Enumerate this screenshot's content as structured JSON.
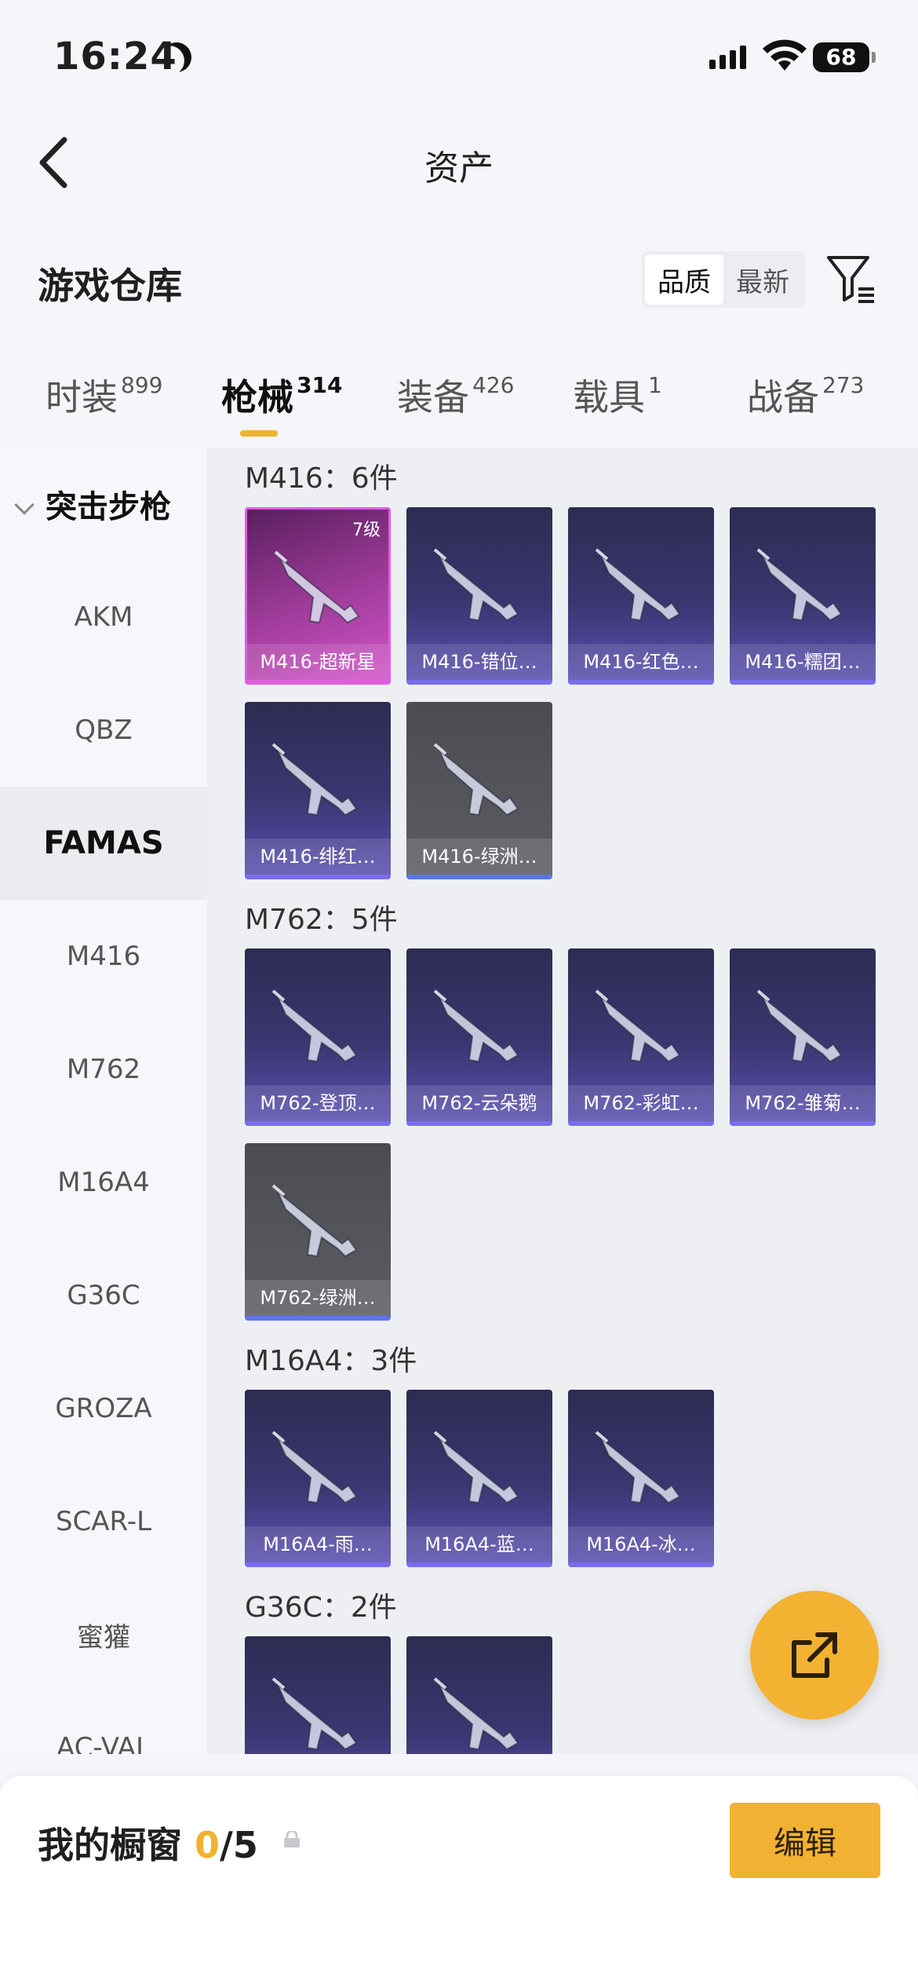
{
  "status": {
    "time": "16:24",
    "battery": "68"
  },
  "nav": {
    "title": "资产"
  },
  "warehouse": {
    "title": "游戏仓库",
    "sort": [
      "品质",
      "最新"
    ],
    "active_sort": "品质"
  },
  "tabs": [
    {
      "label": "时装",
      "count": "899"
    },
    {
      "label": "枪械",
      "count": "314"
    },
    {
      "label": "装备",
      "count": "426"
    },
    {
      "label": "载具",
      "count": "1"
    },
    {
      "label": "战备",
      "count": "273"
    }
  ],
  "sidebar": {
    "category": "突击步枪",
    "items": [
      "AKM",
      "QBZ",
      "FAMAS",
      "M416",
      "M762",
      "M16A4",
      "G36C",
      "GROZA",
      "SCAR-L",
      "蜜獾",
      "AC-VAL"
    ],
    "active": "FAMAS"
  },
  "groups": [
    {
      "title": "M416：6件",
      "items": [
        {
          "name": "M416-超新星",
          "level": "7级",
          "rarity": "purple"
        },
        {
          "name": "M416-错位…",
          "rarity": "blue"
        },
        {
          "name": "M416-红色…",
          "rarity": "blue"
        },
        {
          "name": "M416-糯团…",
          "rarity": "blue"
        },
        {
          "name": "M416-绯红…",
          "rarity": "blue"
        },
        {
          "name": "M416-绿洲…",
          "rarity": "grey"
        }
      ]
    },
    {
      "title": "M762：5件",
      "items": [
        {
          "name": "M762-登顶…",
          "rarity": "blue"
        },
        {
          "name": "M762-云朵鹅",
          "rarity": "blue"
        },
        {
          "name": "M762-彩虹…",
          "rarity": "blue"
        },
        {
          "name": "M762-雏菊…",
          "rarity": "blue"
        },
        {
          "name": "M762-绿洲…",
          "rarity": "grey"
        }
      ]
    },
    {
      "title": "M16A4：3件",
      "items": [
        {
          "name": "M16A4-雨…",
          "rarity": "blue"
        },
        {
          "name": "M16A4-蓝…",
          "rarity": "blue"
        },
        {
          "name": "M16A4-冰…",
          "rarity": "blue"
        }
      ]
    },
    {
      "title": "G36C：2件",
      "items": [
        {
          "name": "",
          "rarity": "blue"
        },
        {
          "name": "",
          "rarity": "blue"
        }
      ]
    }
  ],
  "showcase": {
    "label": "我的橱窗",
    "used": "0",
    "total": "/5",
    "edit_label": "编辑"
  },
  "colors": {
    "accent": "#f1b233",
    "epic": "#e45be0",
    "rare": "#7a6cf0"
  }
}
